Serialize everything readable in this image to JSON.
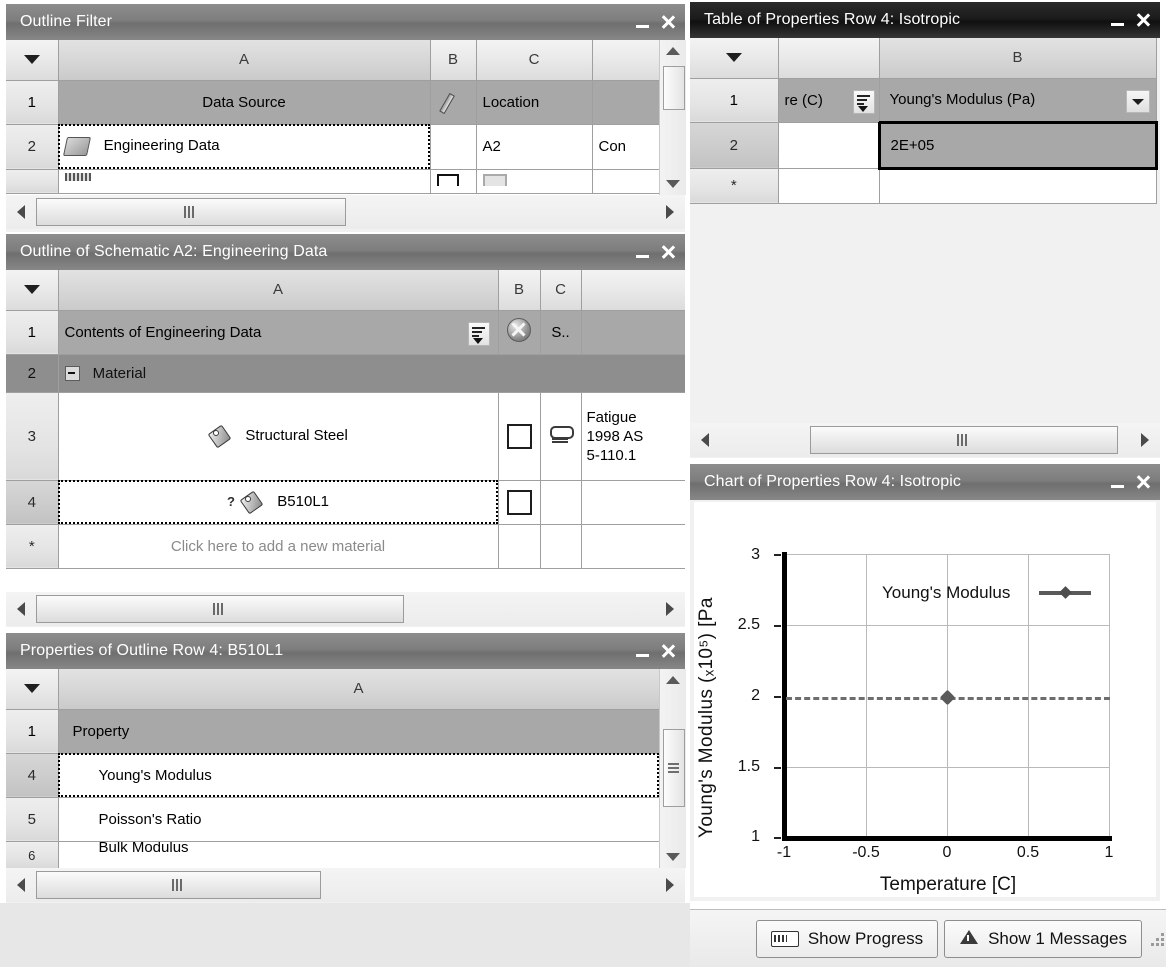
{
  "app": {
    "background_color": "#e7e7e7"
  },
  "panels": {
    "outline_filter": {
      "title": "Outline Filter",
      "minimize_label": "Minimize",
      "close_label": "Close",
      "columns": [
        "",
        "A",
        "B",
        "C",
        ""
      ],
      "rows": [
        {
          "num": "1",
          "header": true,
          "a": "Data Source",
          "b": "pencil-icon",
          "c": "Location",
          "d": ""
        },
        {
          "num": "2",
          "selected": true,
          "a": "Engineering Data",
          "a_icon": "book-icon",
          "b": "",
          "c": "A2",
          "d": "Con"
        },
        {
          "num": "3",
          "partial": true,
          "a": "",
          "b": "",
          "c": "",
          "d": ""
        }
      ]
    },
    "outline_schematic": {
      "title": "Outline of Schematic A2: Engineering Data",
      "columns": [
        "",
        "A",
        "B",
        "C",
        ""
      ],
      "rows": [
        {
          "num": "1",
          "header": true,
          "a": "Contents of Engineering Data",
          "a_icon": "sort-filter-icon",
          "b": "x-ball-icon",
          "c": "S..",
          "d": ""
        },
        {
          "num": "2",
          "group": true,
          "a": "Material",
          "a_icon": "expander-collapse-icon",
          "b": "",
          "c": "",
          "d": ""
        },
        {
          "num": "3",
          "a": "Structural Steel",
          "a_icon": "tag-icon",
          "b": "checkbox",
          "c": "link-icon",
          "d": "Fatigue\n1998 AS\n5-110.1"
        },
        {
          "num": "4",
          "selected": true,
          "a": "B510L1",
          "a_icon": "tag-icon",
          "a_prefix_icon": "question-mark-icon",
          "b": "checkbox",
          "c": "",
          "d": ""
        },
        {
          "num": "*",
          "a": "Click here to add a new material",
          "placeholder": true,
          "b": "",
          "c": "",
          "d": ""
        }
      ]
    },
    "properties_outline": {
      "title": "Properties of Outline Row 4: B510L1",
      "columns": [
        "",
        "A"
      ],
      "rows": [
        {
          "num": "1",
          "header": true,
          "a": "Property"
        },
        {
          "num": "4",
          "selected": true,
          "a": "Young's Modulus"
        },
        {
          "num": "5",
          "a": "Poisson's Ratio"
        },
        {
          "num": "6",
          "partial": true,
          "a": "Bulk Modulus"
        }
      ]
    },
    "table_properties": {
      "title": "Table of Properties Row 4: Isotropic ",
      "columns": [
        "",
        "",
        "B"
      ],
      "rows": [
        {
          "num": "1",
          "header": true,
          "a": "re (C)",
          "a_icon": "sort-filter-icon",
          "b": "Young's Modulus (Pa)",
          "b_icon": "dropdown-arrow-icon"
        },
        {
          "num": "2",
          "a": "",
          "b": "2E+05",
          "b_selected": true
        },
        {
          "num": "*",
          "a": "",
          "b": ""
        }
      ]
    },
    "chart_properties": {
      "title": "Chart of Properties Row 4: Isotropic"
    }
  },
  "chart_data": {
    "type": "line",
    "title": "Chart of Properties Row 4: Isotropic",
    "xlabel": "Temperature [C]",
    "ylabel": "Young's Modulus (×10⁵) [Pa]",
    "ylabel_main": "Young's Modulus (ₓ10⁵) [Pa",
    "xlim": [
      -1,
      1
    ],
    "ylim": [
      1,
      3
    ],
    "xticks": [
      -1,
      -0.5,
      0,
      0.5,
      1
    ],
    "xticklabels": [
      "-1",
      "-0.5",
      "0",
      "0.5",
      "1"
    ],
    "yticks": [
      1,
      1.5,
      2,
      2.5,
      3
    ],
    "yticklabels": [
      "1",
      "1.5",
      "2",
      "2.5",
      "3"
    ],
    "grid": true,
    "legend_position": "top-center",
    "series": [
      {
        "name": "Young's Modulus",
        "linestyle": "dashed",
        "color": "#6e6e6e",
        "x": [
          -1,
          0,
          1
        ],
        "y": [
          2,
          2,
          2
        ],
        "markers": [
          {
            "x": 0,
            "y": 2
          }
        ]
      }
    ]
  },
  "statusbar": {
    "show_progress": "Show Progress",
    "show_messages": "Show 1 Messages",
    "progress_icon": "progress-icon",
    "messages_icon": "warning-icon",
    "resize_grip": "resize-grip"
  }
}
